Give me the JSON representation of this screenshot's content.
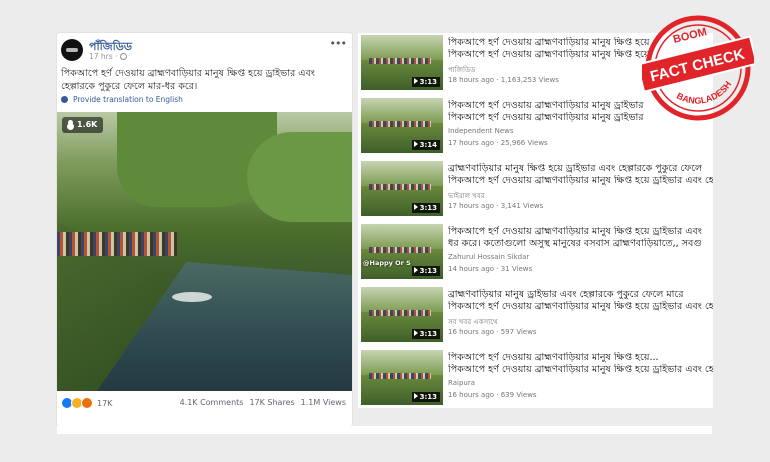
{
  "facebook_post": {
    "page_name": "পাঁজিডিড",
    "time": "17 hrs ·",
    "text": "পিকআপে হর্ণ দেওয়ায় ব্রাহ্মণবাড়িয়ার মানুষ ক্ষিপ্ত হয়ে ড্রাইভার এবং হেল্পারকে পুকুরে ফেলে মার-ধর করে।",
    "translate_label": "Provide translation to English",
    "video_views": "1.6K",
    "reactions_count": "17K",
    "comments": "4.1K Comments",
    "shares": "17K Shares",
    "views": "1.1M Views",
    "colors": {
      "link": "#385898",
      "like": "#1877f2"
    }
  },
  "youtube_results": [
    {
      "title_line1": "পিকআপে হর্ণ দেওয়ায় ব্রাহ্মণবাড়িয়ার মানুষ ক্ষিপ্ত হয়ে",
      "title_line2": "পিকআপে হর্ণ দেওয়ায় ব্রাহ্মণবাড়িয়ার মানুষ ক্ষিপ্ত হয়ে",
      "channel": "পাজিডিড",
      "meta": "18 hours ago · 1,163,253 Views",
      "duration": "3:13",
      "watermark": ""
    },
    {
      "title_line1": "পিকআপে হর্ণ দেওয়ায় ব্রাহ্মণবাড়িয়ার মানুষ ড্রাইভার",
      "title_line2": "পিকআপে হর্ণ দেওয়ায় ব্রাহ্মণবাড়িয়ার মানুষ ড্রাইভার",
      "channel": "Independent News",
      "meta": "17 hours ago · 25,966 Views",
      "duration": "3:14",
      "watermark": ""
    },
    {
      "title_line1": "ব্রাহ্মণবাড়িয়ার মানুষ ক্ষিপ্ত হয়ে ড্রাইভার এবং হেল্পারকে পুকুরে ফেলে",
      "title_line2": "পিকআপে হর্ণ দেওয়ায় ব্রাহ্মণবাড়িয়ার মানুষ ক্ষিপ্ত হয়ে ড্রাইভার এবং হেল্প",
      "channel": "ভাইরাল খবর",
      "meta": "17 hours ago · 3,141 Views",
      "duration": "3:13",
      "watermark": ""
    },
    {
      "title_line1": "পিকআপে হর্ণ দেওয়ায় ব্রাহ্মণবাড়িয়ার মানুষ ক্ষিপ্ত হয়ে ড্রাইভার এবং",
      "title_line2": "ধর করে। কতোগুলো অসুস্থ মানুষের বসবাস ব্রাহ্মণবাড়িয়াতে,, সবগু",
      "channel": "Zahurul Hossain Sikdar",
      "meta": "14 hours ago · 31 Views",
      "duration": "3:13",
      "watermark": "@Happy Or S"
    },
    {
      "title_line1": "ব্রাহ্মণবাড়িয়ার মানুষ ড্রাইভার এবং হেল্পারকে পুকুরে ফেলে মারে",
      "title_line2": "পিকআপে হর্ণ দেওয়ায় ব্রাহ্মণবাড়িয়ার মানুষ ক্ষিপ্ত হয়ে ড্রাইভার এবং হেল্প",
      "channel": "সব খবর একসাথে",
      "meta": "16 hours ago · 597 Views",
      "duration": "3:13",
      "watermark": ""
    },
    {
      "title_line1": "পিকআপে হর্ণ দেওয়ায় ব্রাহ্মণবাড়িয়ার মানুষ ক্ষিপ্ত হয়ে...",
      "title_line2": "পিকআপে হর্ণ দেওয়ায় ব্রাহ্মণবাড়িয়ার মানুষ ক্ষিপ্ত হয়ে ড্রাইভার এবং হেল্প",
      "channel": "Raipura",
      "meta": "16 hours ago · 639 Views",
      "duration": "3:13",
      "watermark": ""
    }
  ],
  "stamp": {
    "top": "BOOM",
    "main": "FACT CHECK",
    "bottom": "BANGLADESH",
    "color": "#e0242a"
  }
}
